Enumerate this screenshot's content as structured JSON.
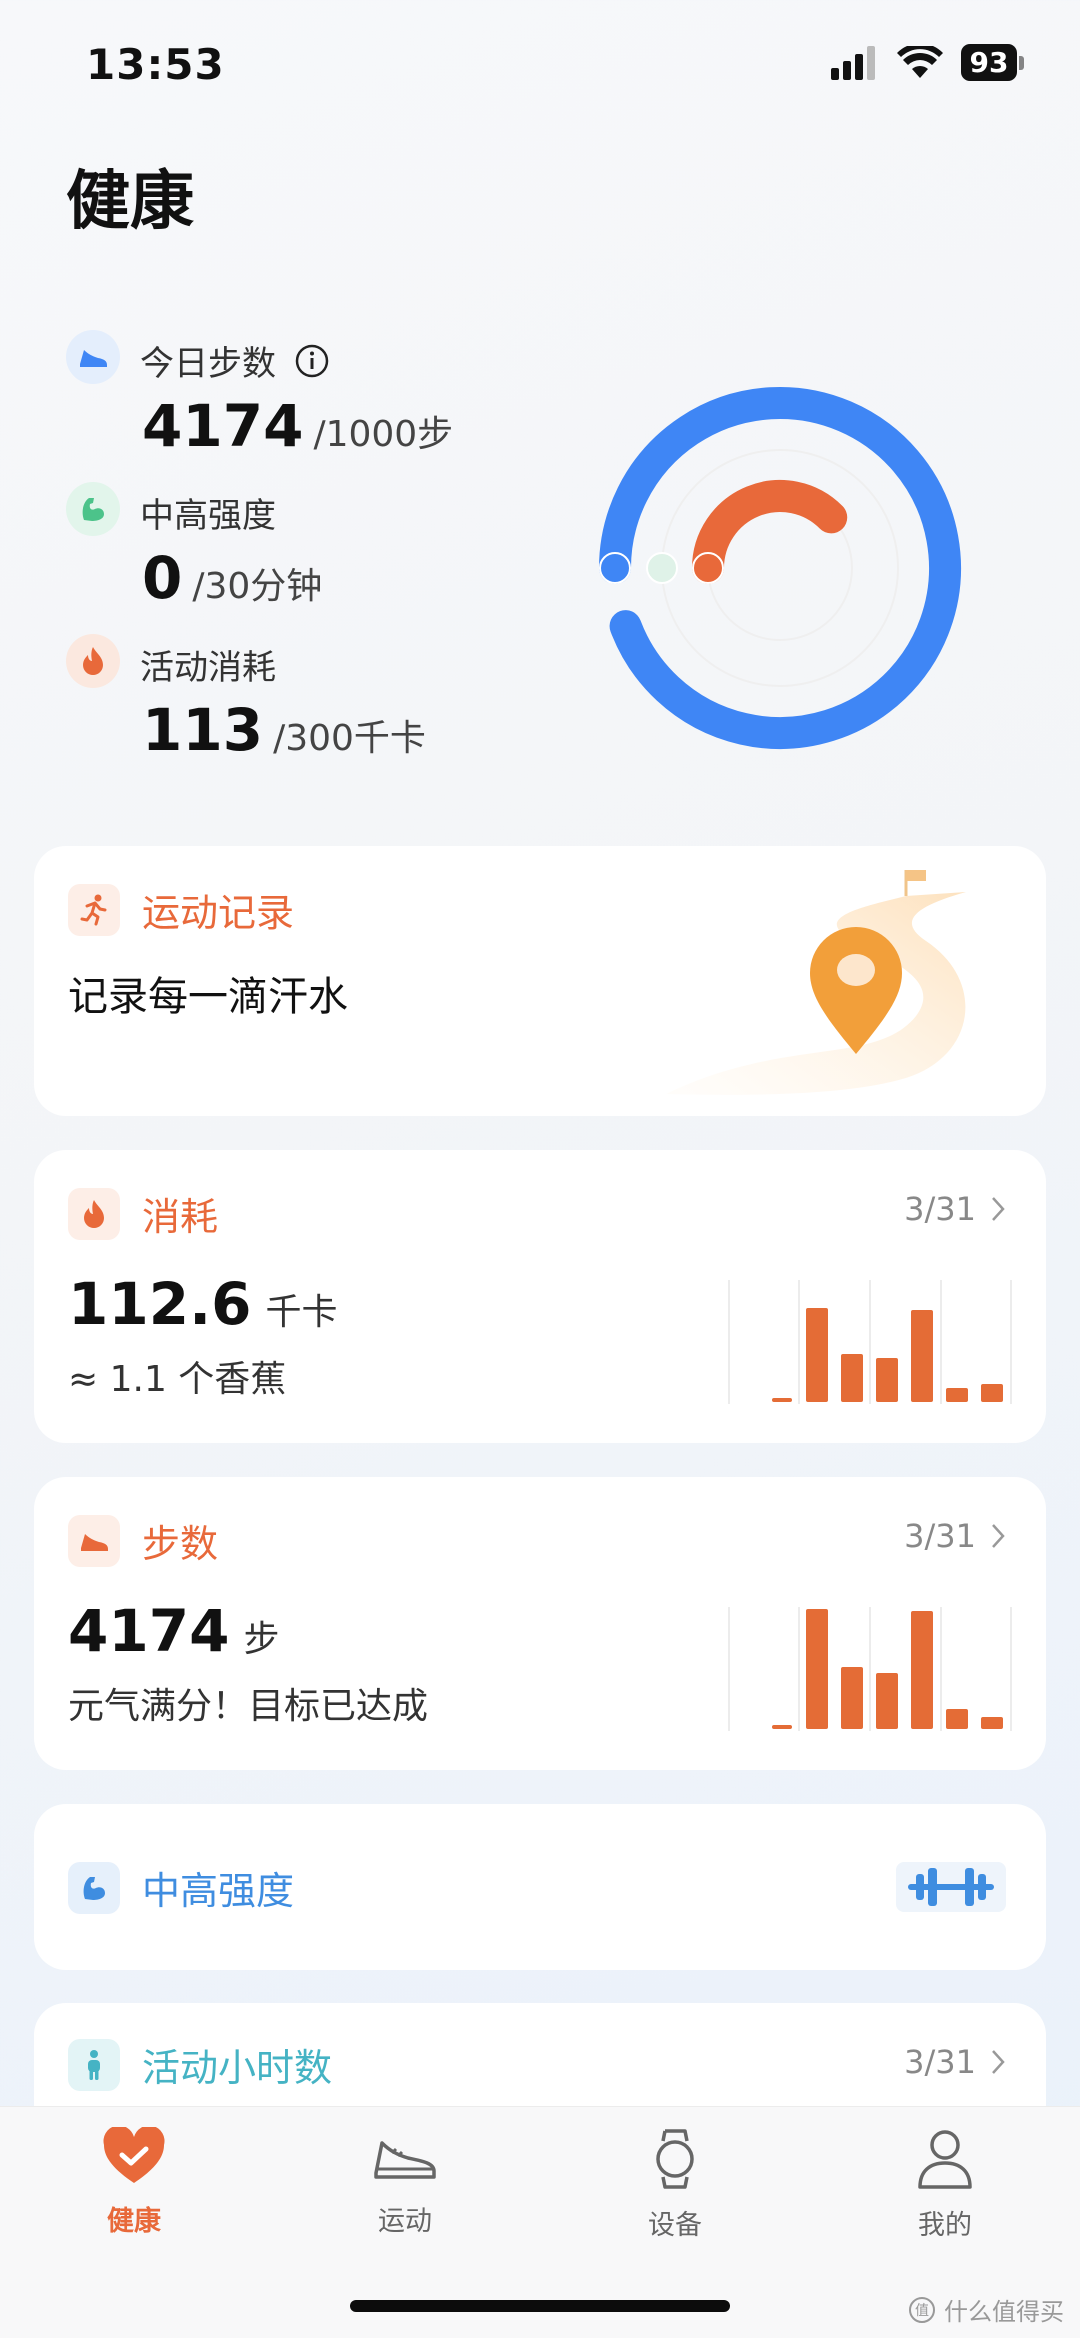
{
  "status_bar": {
    "time": "13:53",
    "battery": "93"
  },
  "page_title": "健康",
  "metrics": [
    {
      "label": "今日步数",
      "value": "4174",
      "goal": "/1000步",
      "icon": "shoe-icon",
      "color": "#3f86f5",
      "ratio": 1.0
    },
    {
      "label": "中高强度",
      "value": "0",
      "goal": "/30分钟",
      "icon": "muscle-icon",
      "color": "#4cc38a",
      "ratio": 0.0
    },
    {
      "label": "活动消耗",
      "value": "113",
      "goal": "/300千卡",
      "icon": "flame-icon",
      "color": "#e8693a",
      "ratio": 0.376
    }
  ],
  "cards": {
    "exercise": {
      "title": "运动记录",
      "subtitle": "记录每一滴汗水",
      "icon": "running-person-icon"
    },
    "calories": {
      "title": "消耗",
      "date": "3/31",
      "value": "112.6",
      "unit": "千卡",
      "note": "≈ 1.1 个香蕉",
      "icon": "flame-icon"
    },
    "steps": {
      "title": "步数",
      "date": "3/31",
      "value": "4174",
      "unit": "步",
      "note": "元气满分！目标已达成",
      "icon": "shoe-icon"
    },
    "intensity": {
      "title": "中高强度",
      "icon": "muscle-icon"
    },
    "active_hours": {
      "title": "活动小时数",
      "date": "3/31",
      "icon": "standing-person-icon"
    }
  },
  "tabs": [
    {
      "label": "健康",
      "icon": "heart-check-icon",
      "active": true
    },
    {
      "label": "运动",
      "icon": "sneaker-icon",
      "active": false
    },
    {
      "label": "设备",
      "icon": "watch-icon",
      "active": false
    },
    {
      "label": "我的",
      "icon": "person-icon",
      "active": false
    }
  ],
  "watermark": "什么值得买",
  "colors": {
    "orange": "#e8693a",
    "blue": "#3f86f5",
    "green": "#4cc38a",
    "cyan": "#45b3c4",
    "intensity_blue": "#3f8de0"
  }
}
